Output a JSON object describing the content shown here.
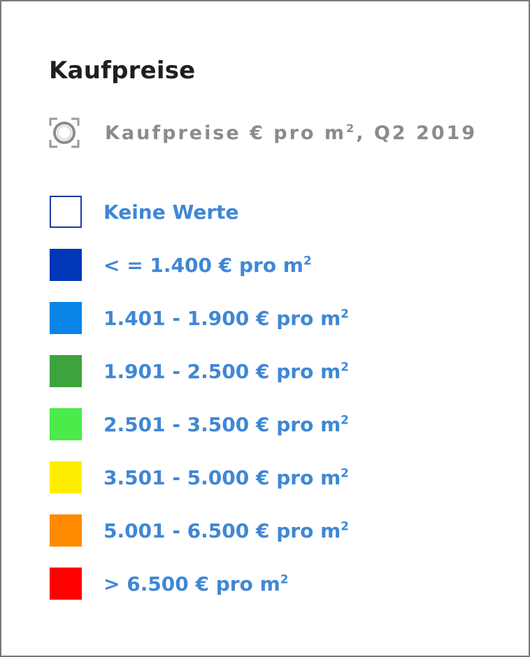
{
  "panel": {
    "title": "Kaufpreise",
    "layer": {
      "icon": "layer-toggle-icon",
      "label": "Kaufpreise € pro m², Q2 2019"
    }
  },
  "legend": {
    "items": [
      {
        "label": "Keine Werte",
        "color": "#ffffff",
        "border": "#1e3c9e"
      },
      {
        "label": "< = 1.400 € pro m²",
        "color": "#0036b8"
      },
      {
        "label": "1.401 - 1.900 € pro m²",
        "color": "#0a84e6"
      },
      {
        "label": "1.901 - 2.500 € pro m²",
        "color": "#3da43d"
      },
      {
        "label": "2.501 - 3.500 € pro m²",
        "color": "#4ceb4c"
      },
      {
        "label": "3.501 - 5.000 € pro m²",
        "color": "#ffee00"
      },
      {
        "label": "5.001 - 6.500 € pro m²",
        "color": "#ff8a00"
      },
      {
        "label": "> 6.500 € pro m²",
        "color": "#ff0000"
      }
    ]
  }
}
